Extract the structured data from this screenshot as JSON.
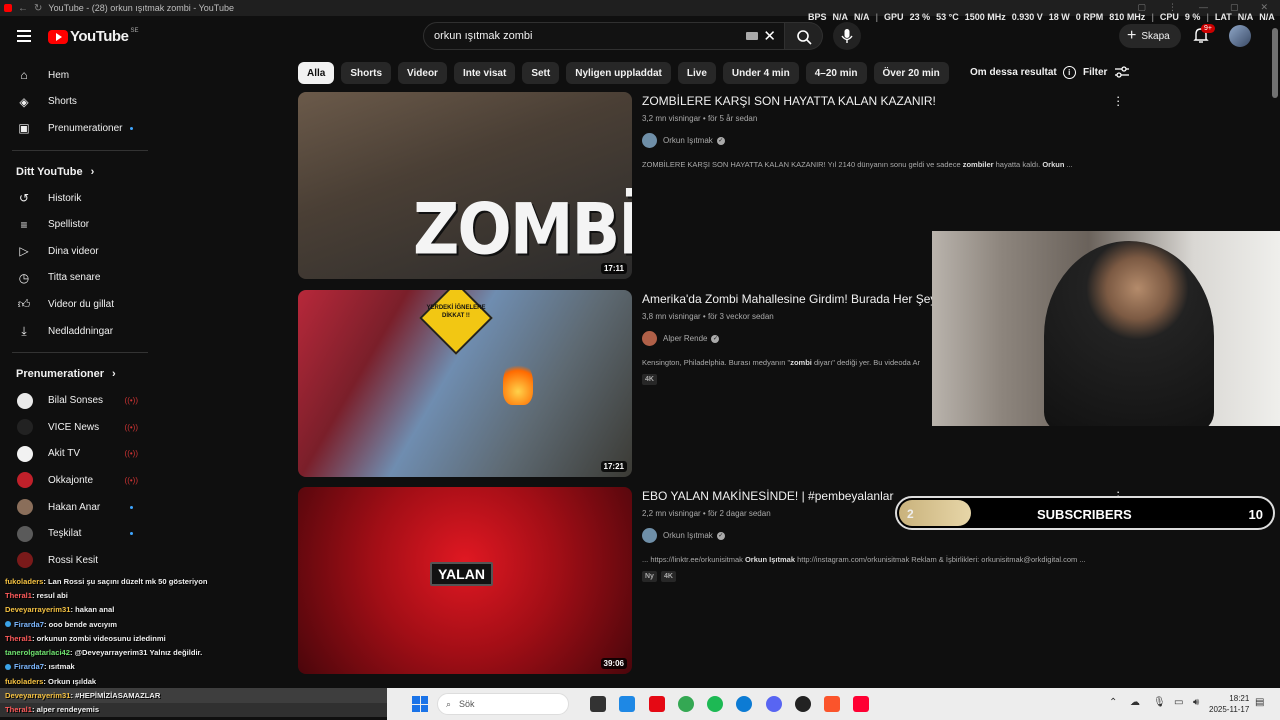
{
  "browser": {
    "title": "YouTube - (28) orkun ışıtmak zombi - YouTube"
  },
  "hud": {
    "bps": "BPS",
    "bps_val1": "N/A",
    "bps_val2": "N/A",
    "gpu": "GPU",
    "gpu_load": "23 %",
    "gpu_temp": "53 °C",
    "gpu_clock": "1500 MHz",
    "gpu_volt": "0.930 V",
    "gpu_power": "18 W",
    "gpu_fan": "0 RPM",
    "gpu_mem": "810 MHz",
    "cpu": "CPU",
    "cpu_load": "9 %",
    "lat": "LAT",
    "lat_val1": "N/A",
    "lat_val2": "N/A"
  },
  "topbar": {
    "logo_text": "YouTube",
    "region": "SE",
    "search_value": "orkun ışıtmak zombi",
    "create_label": "Skapa",
    "notif_badge": "9+"
  },
  "sidebar": {
    "main": [
      {
        "label": "Hem",
        "icon": "home-icon"
      },
      {
        "label": "Shorts",
        "icon": "shorts-icon"
      },
      {
        "label": "Prenumerationer",
        "icon": "subscriptions-icon"
      }
    ],
    "you_header": "Ditt YouTube",
    "you": [
      {
        "label": "Historik",
        "icon": "history-icon"
      },
      {
        "label": "Spellistor",
        "icon": "playlists-icon"
      },
      {
        "label": "Dina videor",
        "icon": "your-videos-icon"
      },
      {
        "label": "Titta senare",
        "icon": "watch-later-icon"
      },
      {
        "label": "Videor du gillat",
        "icon": "liked-icon"
      },
      {
        "label": "Nedladdningar",
        "icon": "download-icon"
      }
    ],
    "subs_header": "Prenumerationer",
    "subs": [
      {
        "label": "Bilal Sonses",
        "status": "live",
        "color": "#e9e9e9"
      },
      {
        "label": "VICE News",
        "status": "live",
        "color": "#222222"
      },
      {
        "label": "Akit TV",
        "status": "live",
        "color": "#f2f2f2"
      },
      {
        "label": "Okkajonte",
        "status": "live",
        "color": "#c0202a"
      },
      {
        "label": "Hakan Anar",
        "status": "new",
        "color": "#8a6e5a"
      },
      {
        "label": "Teşkilat",
        "status": "new",
        "color": "#5a5a5a"
      },
      {
        "label": "Rossi Kesit",
        "status": "",
        "color": "#7a1a1a"
      }
    ]
  },
  "chips": [
    "Alla",
    "Shorts",
    "Videor",
    "Inte visat",
    "Sett",
    "Nyligen uppladdat",
    "Live",
    "Under 4 min",
    "4–20 min",
    "Över 20 min"
  ],
  "about_label": "Om dessa resultat",
  "filter_label": "Filter",
  "videos": [
    {
      "title": "ZOMBİLERE KARŞI SON HAYATTA KALAN KAZANIR!",
      "stats": "3,2 mn visningar • för 5 år sedan",
      "channel": "Orkun Işıtmak",
      "desc_pre": "ZOMBİLERE KARŞI SON HAYATTA KALAN KAZANIR! Yıl 2140 dünyanın sonu geldi ve sadece ",
      "desc_bold1": "zombiler",
      "desc_mid": " hayatta kaldı. ",
      "desc_bold2": "Orkun",
      "desc_post": " ...",
      "duration": "17:11",
      "thumb_text": "ZOMBİ VS",
      "badges": []
    },
    {
      "title": "Amerika'da Zombi Mahallesine Girdim! Burada Her Şey",
      "stats": "3,8 mn visningar • för 3 veckor sedan",
      "channel": "Alper Rende",
      "desc_pre": "Kensington, Philadelphia. Burası medyanın \"",
      "desc_bold1": "zombi",
      "desc_mid": " diyarı\" dediği yer. Bu videoda Ar",
      "desc_bold2": "",
      "desc_post": "",
      "duration": "17:21",
      "thumb_text": "YERDEKİ İĞNELERE DİKKAT !!",
      "badges": [
        "4K"
      ]
    },
    {
      "title": "EBO YALAN MAKİNESİNDE! | #pembeyalanlar",
      "stats": "2,2 mn visningar • för 2 dagar sedan",
      "channel": "Orkun Işıtmak",
      "desc_pre": "... https://linktr.ee/orkunisitmak ",
      "desc_bold1": "Orkun Işıtmak",
      "desc_mid": " http://instagram.com/orkunisitmak Reklam & İşbirlikleri: orkunisitmak@orkdigital.com ...",
      "desc_bold2": "",
      "desc_post": "",
      "duration": "39:06",
      "thumb_text": "YALAN",
      "badges": [
        "Ny",
        "4K"
      ]
    }
  ],
  "subgoal": {
    "current": "2",
    "label": "SUBSCRIBERS",
    "goal": "10",
    "progress_fraction": 0.2
  },
  "chat": [
    {
      "user": "fukoladers",
      "color": "#f5c242",
      "msg": " : Lan Rossi şu saçını düzelt mk 50 gösteriyon",
      "hl": false,
      "icon": false
    },
    {
      "user": "Theral1",
      "color": "#ff5b5b",
      "msg": " : resul abi",
      "hl": false,
      "icon": false
    },
    {
      "user": "Deveyarrayerim31",
      "color": "#f5c242",
      "msg": " : hakan anal",
      "hl": false,
      "icon": false
    },
    {
      "user": "Firarda7",
      "color": "#7db8ff",
      "msg": " : ooo bende avcıyım",
      "hl": false,
      "icon": true
    },
    {
      "user": "Theral1",
      "color": "#ff5b5b",
      "msg": " : orkunun zombi videosunu izledinmi",
      "hl": false,
      "icon": false
    },
    {
      "user": "tanerolgatarlaci42",
      "color": "#6fe36f",
      "msg": " : @Deveyarrayerim31 Yalnız değildir.",
      "hl": false,
      "icon": false
    },
    {
      "user": "Firarda7",
      "color": "#7db8ff",
      "msg": " : ısıtmak",
      "hl": false,
      "icon": true
    },
    {
      "user": "fukoladers",
      "color": "#f5c242",
      "msg": " : Orkun ışıldak",
      "hl": false,
      "icon": false
    },
    {
      "user": "Deveyarrayerim31",
      "color": "#f5c242",
      "msg": " : #HEPİMİZİASAMAZLAR",
      "hl": true,
      "icon": false
    },
    {
      "user": "Theral1",
      "color": "#ff5b5b",
      "msg": " : alper rendeyemis",
      "hl": false,
      "icon": false
    }
  ],
  "taskbar": {
    "search_placeholder": "Sök",
    "time": "18:21",
    "date": "2025-11-17"
  }
}
